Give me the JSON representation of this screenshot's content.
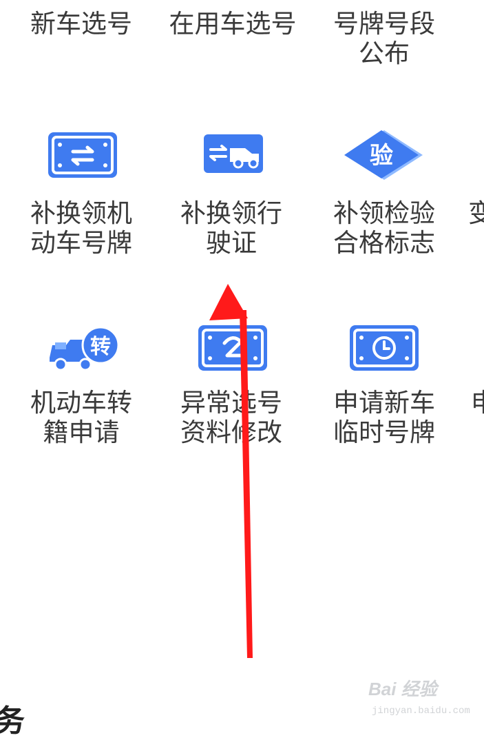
{
  "grid": {
    "row1": [
      "新车选号",
      "在用车选号",
      "号牌号段",
      "公布"
    ],
    "row2": [
      {
        "line1": "补换领机",
        "line2": "动车号牌",
        "icon": "plate-swap-icon"
      },
      {
        "line1": "补换领行",
        "line2": "驶证",
        "icon": "car-swap-icon"
      },
      {
        "line1": "补领检验",
        "line2": "合格标志",
        "icon": "inspection-badge-icon",
        "badge_text": "验"
      },
      {
        "line1": "变",
        "line2": ""
      }
    ],
    "row3": [
      {
        "line1": "机动车转",
        "line2": "籍申请",
        "icon": "truck-transfer-icon",
        "badge_text": "转"
      },
      {
        "line1": "异常选号",
        "line2": "资料修改",
        "icon": "plate-edit-icon"
      },
      {
        "line1": "申请新车",
        "line2": "临时号牌",
        "icon": "plate-clock-icon"
      },
      {
        "line1": "申",
        "line2": ""
      }
    ]
  },
  "section": {
    "title": "务"
  },
  "watermark": {
    "brand": "Bai 经验",
    "url": "jingyan.baidu.com"
  },
  "colors": {
    "accent": "#3f7bf0",
    "icon_light": "#7fb0ff",
    "arrow": "#ff1a1a"
  }
}
